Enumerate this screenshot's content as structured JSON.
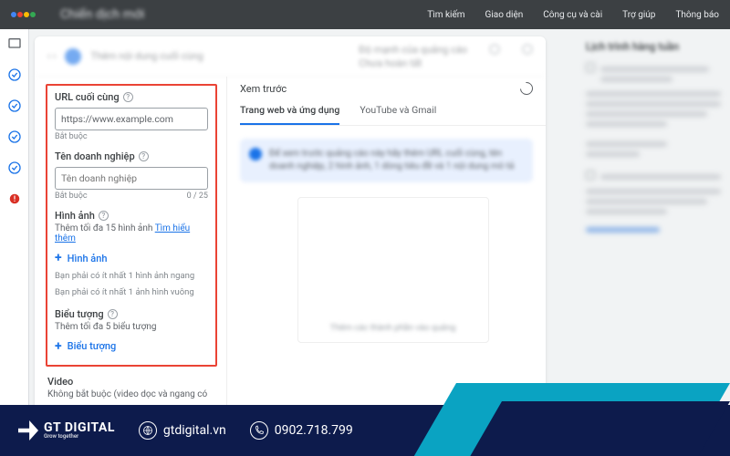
{
  "topbar": {
    "page_title": "Chiến dịch mới",
    "menu": [
      "Tìm kiếm",
      "Giao diện",
      "Công cụ và cài",
      "Trợ giúp",
      "Thông báo"
    ]
  },
  "stepper": {
    "current": "Thêm nội dung cuối cùng",
    "group_label": "Độ mạnh của quảng cáo",
    "group_sub": "Chưa hoàn tất"
  },
  "form": {
    "final_url": {
      "label": "URL cuối cùng",
      "value": "https://www.example.com",
      "required": "Bắt buộc"
    },
    "business": {
      "label": "Tên doanh nghiệp",
      "placeholder": "Tên doanh nghiệp",
      "required": "Bắt buộc",
      "counter": "0 / 25"
    },
    "images": {
      "label": "Hình ảnh",
      "hint_prefix": "Thêm tối đa 15 hình ảnh ",
      "learn_more": "Tìm hiểu thêm",
      "add": "Hình ảnh",
      "req1": "Bạn phải có ít nhất 1 hình ảnh ngang",
      "req2": "Bạn phải có ít nhất 1 ảnh hình vuông"
    },
    "logos": {
      "label": "Biểu tượng",
      "hint": "Thêm tối đa 5 biểu tượng",
      "add": "Biểu tượng"
    },
    "video": {
      "label": "Video",
      "hint": "Không bắt buộc (video dọc và ngang có"
    }
  },
  "preview": {
    "title": "Xem trước",
    "tabs": {
      "web": "Trang web và ứng dụng",
      "yt": "YouTube và Gmail"
    },
    "notice": "Để xem trước quảng cáo này hãy thêm URL cuối cùng, tên doanh nghiệp, 2 hình ảnh, 1 dòng tiêu đề và 1 nội dung mô tả",
    "placeholder_caption": "Thêm các thành phần vào quảng"
  },
  "rightside": {
    "title": "Lịch trình hàng tuần"
  },
  "footer": {
    "brand": "GT DIGITAL",
    "tagline": "Grow together",
    "site": "gtdigital.vn",
    "phone": "0902.718.799"
  }
}
